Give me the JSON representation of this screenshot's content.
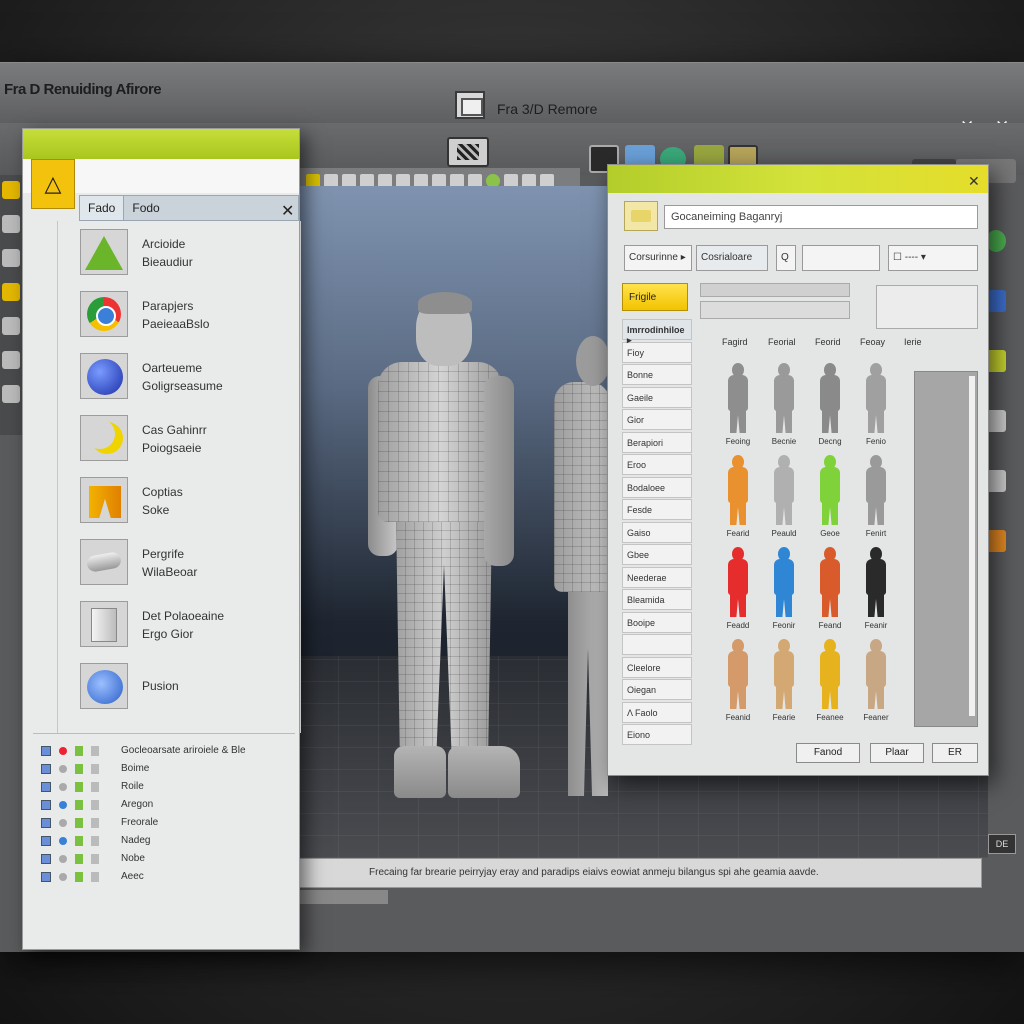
{
  "window": {
    "app_title": "Fra D Renuiding Afirore",
    "doc_title": "Fra 3/D Remore",
    "controls": "✕ ✕ ✕"
  },
  "library": {
    "logo_glyph": "△",
    "tabs": [
      "Fado",
      "Fodo"
    ],
    "close": "✕",
    "items": [
      {
        "label": "Arcioide\nBieaudiur",
        "icon": "triangle-icon"
      },
      {
        "label": "Parapjers\nPaeieaaBslo",
        "icon": "chrome-sphere-icon"
      },
      {
        "label": "Oarteueme\nGoligrseasume",
        "icon": "blue-sphere-icon"
      },
      {
        "label": "Cas Gahinrr\nPoiogsaeie",
        "icon": "moon-icon"
      },
      {
        "label": "Coptias\nSoke",
        "icon": "trousers-icon"
      },
      {
        "label": "Pergrife\nWilaBeoar",
        "icon": "cylinder-icon"
      },
      {
        "label": "Det Polaoeaine\nErgo Gior",
        "icon": "pane-icon"
      },
      {
        "label": "Pusion",
        "icon": "disc-icon"
      }
    ],
    "scenes": [
      {
        "label": "Gocleoarsate ariroiele & Ble",
        "dot": "r"
      },
      {
        "label": "Boime",
        "dot": ""
      },
      {
        "label": "Roile",
        "dot": ""
      },
      {
        "label": "Aregon",
        "dot": "b"
      },
      {
        "label": "Freorale",
        "dot": ""
      },
      {
        "label": "Nadeg",
        "dot": "b"
      },
      {
        "label": "Nobe",
        "dot": ""
      },
      {
        "label": "Aeec",
        "dot": ""
      }
    ]
  },
  "dialog": {
    "close": "✕",
    "search_value": "Gocaneiming Baganryj",
    "dropdown1": "Corsurinne ▸",
    "dropdown2": "Cosrialoare",
    "small1": "Q",
    "small3": "☐ ---- ▾",
    "selected_category": "Frigile",
    "categories_header": "Imrrodinhiloe ▸",
    "categories": [
      "Fioy",
      "Bonne",
      "Gaeile",
      "Gior",
      "Berapiori",
      "Eroo",
      "Bodaloee",
      "Fesde",
      "Gaiso",
      "Gbee",
      "Neederae",
      "Bleamida",
      "Booipe",
      "",
      "Cleelore",
      "Oiegan",
      "Λ Faolo",
      "Eiono"
    ],
    "column_headers": [
      "Fagird",
      "Feorial",
      "Feorid",
      "Feoay",
      "Ierie"
    ],
    "characters": [
      {
        "color": "#8e8e8e",
        "label": "Feoing"
      },
      {
        "color": "#9a9a9a",
        "label": "Becnie"
      },
      {
        "color": "#8a8a8a",
        "label": "Decng"
      },
      {
        "color": "#a0a0a0",
        "label": "Fenio"
      },
      {
        "color": "#e8912e",
        "label": "Fearid"
      },
      {
        "color": "#b0b0b0",
        "label": "Peauld"
      },
      {
        "color": "#7fd23a",
        "label": "Geoe"
      },
      {
        "color": "#9a9a9a",
        "label": "Fenirt"
      },
      {
        "color": "#e52d2d",
        "label": "Feadd"
      },
      {
        "color": "#2e86d4",
        "label": "Feonir"
      },
      {
        "color": "#d95b2b",
        "label": "Feand"
      },
      {
        "color": "#2a2a2a",
        "label": "Feanir"
      },
      {
        "color": "#d49a6a",
        "label": "Feanid"
      },
      {
        "color": "#d4a872",
        "label": "Fearie"
      },
      {
        "color": "#e6b21e",
        "label": "Feanee"
      },
      {
        "color": "#c8a884",
        "label": "Feaner"
      }
    ],
    "buttons": [
      "Fanod",
      "Plaar",
      "ER"
    ]
  },
  "status_text": "Frecaing far brearie peirryjay eray and paradips eiaivs eowiat anmeju bilangus spi ahe geamia aavde.",
  "corner_label": "DE"
}
